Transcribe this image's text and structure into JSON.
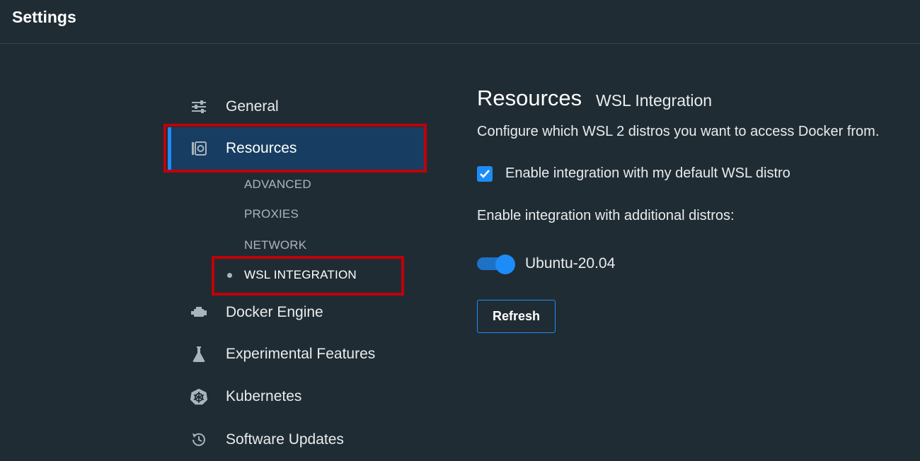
{
  "window": {
    "title": "Settings"
  },
  "sidebar": {
    "items": [
      {
        "id": "general",
        "label": "General",
        "icon": "sliders-icon"
      },
      {
        "id": "resources",
        "label": "Resources",
        "icon": "resources-icon",
        "active": true
      },
      {
        "id": "docker-engine",
        "label": "Docker Engine",
        "icon": "engine-icon"
      },
      {
        "id": "experimental",
        "label": "Experimental Features",
        "icon": "flask-icon"
      },
      {
        "id": "kubernetes",
        "label": "Kubernetes",
        "icon": "kubernetes-icon"
      },
      {
        "id": "software-updates",
        "label": "Software Updates",
        "icon": "history-icon"
      }
    ],
    "resources_sub": [
      {
        "label": "ADVANCED"
      },
      {
        "label": "PROXIES"
      },
      {
        "label": "NETWORK"
      },
      {
        "label": "WSL INTEGRATION",
        "active": true
      }
    ]
  },
  "main": {
    "title": "Resources",
    "subtitle": "WSL Integration",
    "description": "Configure which WSL 2 distros you want to access Docker from.",
    "default_distro": {
      "label": "Enable integration with my default WSL distro",
      "checked": true
    },
    "additional_label": "Enable integration with additional distros:",
    "distros": [
      {
        "name": "Ubuntu-20.04",
        "enabled": true
      }
    ],
    "refresh_label": "Refresh"
  },
  "colors": {
    "background": "#202c33",
    "accent": "#1d8cf8",
    "active_nav": "#173e62",
    "highlight_border": "#c0000a"
  }
}
